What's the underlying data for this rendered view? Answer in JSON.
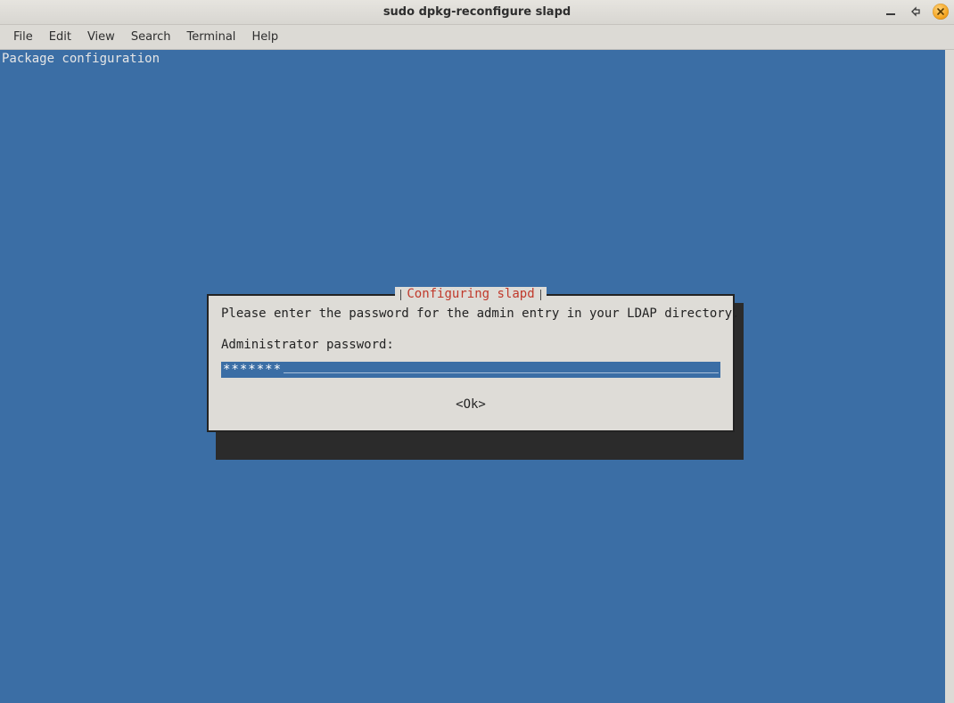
{
  "titlebar": {
    "title": "sudo dpkg-reconfigure slapd"
  },
  "menu": {
    "file": "File",
    "edit": "Edit",
    "view": "View",
    "search": "Search",
    "terminal": "Terminal",
    "help": "Help"
  },
  "terminal": {
    "package_line": "Package configuration",
    "dialog": {
      "title": "Configuring slapd",
      "prompt": "Please enter the password for the admin entry in your LDAP directory.",
      "field_label": "Administrator password:",
      "password_value": "*******",
      "ok_label": "<Ok>"
    }
  }
}
